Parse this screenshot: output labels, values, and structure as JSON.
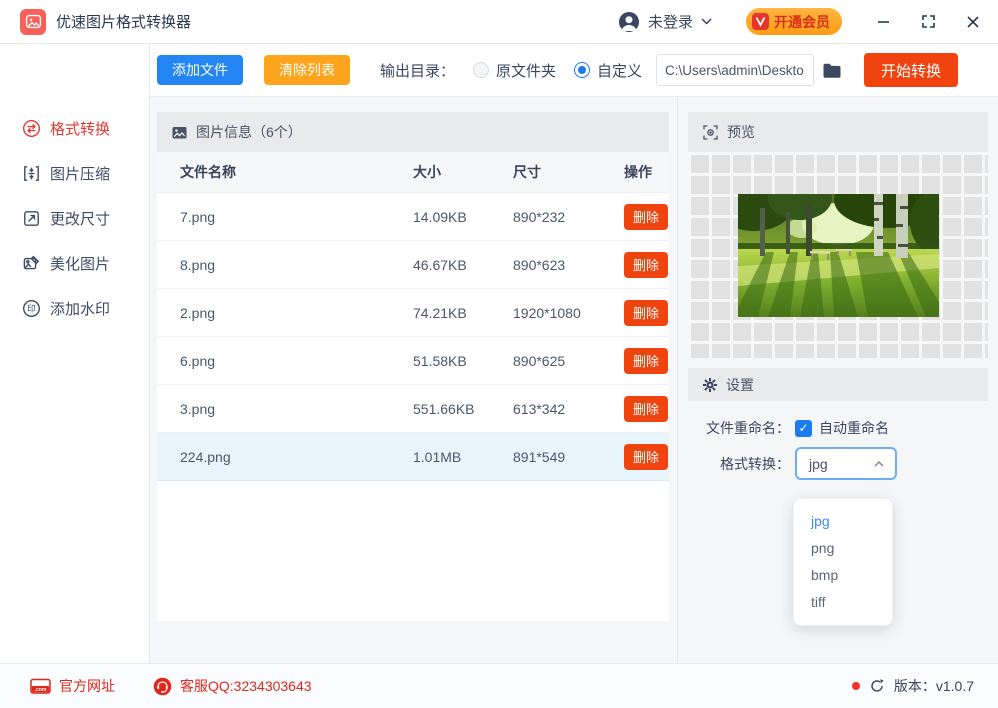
{
  "titlebar": {
    "app_title": "优速图片格式转换器",
    "login_label": "未登录",
    "vip_label": "开通会员"
  },
  "toolbar": {
    "add_files": "添加文件",
    "clear_list": "清除列表",
    "output_dir_label": "输出目录：",
    "radio_original": "原文件夹",
    "radio_custom": "自定义",
    "output_path": "C:\\Users\\admin\\Deskto",
    "start_convert": "开始转换"
  },
  "sidebar": {
    "items": [
      {
        "label": "格式转换",
        "icon": "format-convert-icon",
        "active": true
      },
      {
        "label": "图片压缩",
        "icon": "image-compress-icon",
        "active": false
      },
      {
        "label": "更改尺寸",
        "icon": "resize-icon",
        "active": false
      },
      {
        "label": "美化图片",
        "icon": "beautify-icon",
        "active": false
      },
      {
        "label": "添加水印",
        "icon": "watermark-icon",
        "active": false
      }
    ]
  },
  "file_table": {
    "section_title": "图片信息（6个）",
    "columns": {
      "name": "文件名称",
      "size": "大小",
      "dims": "尺寸",
      "action": "操作"
    },
    "delete_label": "删除",
    "rows": [
      {
        "name": "7.png",
        "size": "14.09KB",
        "dims": "890*232",
        "selected": false
      },
      {
        "name": "8.png",
        "size": "46.67KB",
        "dims": "890*623",
        "selected": false
      },
      {
        "name": "2.png",
        "size": "74.21KB",
        "dims": "1920*1080",
        "selected": false
      },
      {
        "name": "6.png",
        "size": "51.58KB",
        "dims": "890*625",
        "selected": false
      },
      {
        "name": "3.png",
        "size": "551.66KB",
        "dims": "613*342",
        "selected": false
      },
      {
        "name": "224.png",
        "size": "1.01MB",
        "dims": "891*549",
        "selected": true
      }
    ]
  },
  "preview": {
    "title": "预览"
  },
  "settings": {
    "title": "设置",
    "rename_label": "文件重命名：",
    "auto_rename_label": "自动重命名",
    "auto_rename_checked": true,
    "format_label": "格式转换：",
    "selected_format": "jpg",
    "format_options": [
      "jpg",
      "png",
      "bmp",
      "tiff"
    ]
  },
  "footer": {
    "site_label": "官方网址",
    "qq_label": "客服QQ:3234303643",
    "version_label": "版本：v1.0.7"
  },
  "colors": {
    "accent_blue": "#2385f4",
    "accent_orange": "#ffa41d",
    "accent_red_orange": "#f0430f",
    "brand_red": "#e0281e",
    "active_menu_red": "#e23a32",
    "selected_row_bg": "#e9f5fd",
    "band_bg": "#e9eaec",
    "page_bg": "#f5f6f8"
  }
}
